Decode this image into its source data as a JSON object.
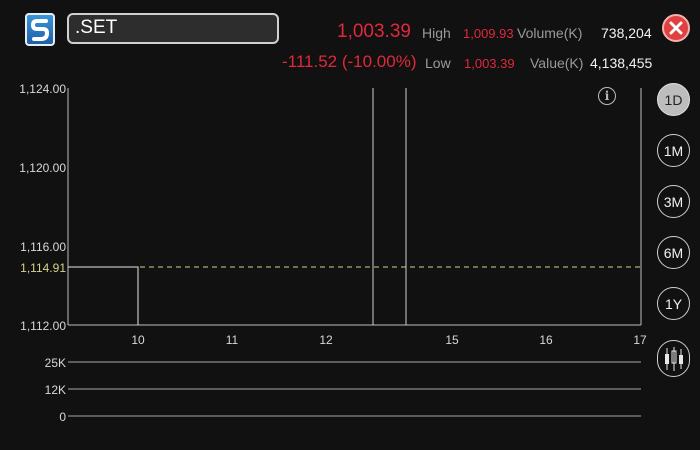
{
  "header": {
    "symbol": ".SET",
    "last_price": "1,003.39",
    "change": "-111.52 (-10.00%)",
    "high_label": "High",
    "high_value": "1,009.93",
    "low_label": "Low",
    "low_value": "1,003.39",
    "volume_label": "Volume(K)",
    "volume_value": "738,204",
    "value_label": "Value(K)",
    "value_value": "4,138,455"
  },
  "colors": {
    "negative": "#e0283c",
    "previous_close_line": "#d8d48a",
    "accent_logo": "#2d7cc4"
  },
  "icons": {
    "logo": "app-logo-icon",
    "close": "close-icon",
    "info": "info-icon",
    "candlestick": "candlestick-icon"
  },
  "chart_data": {
    "type": "line",
    "x_ticks": [
      "10",
      "11",
      "12",
      "15",
      "16",
      "17"
    ],
    "y_ticks": [
      "1,124.00",
      "1,120.00",
      "1,116.00",
      "1,112.00"
    ],
    "ylim": [
      1112,
      1124
    ],
    "previous_close_label": "1,114.91",
    "previous_close": 1114.91,
    "volume_ticks": [
      "25K",
      "12K",
      "0"
    ]
  },
  "periods": [
    "1D",
    "1M",
    "3M",
    "6M",
    "1Y"
  ],
  "active_period": "1D"
}
